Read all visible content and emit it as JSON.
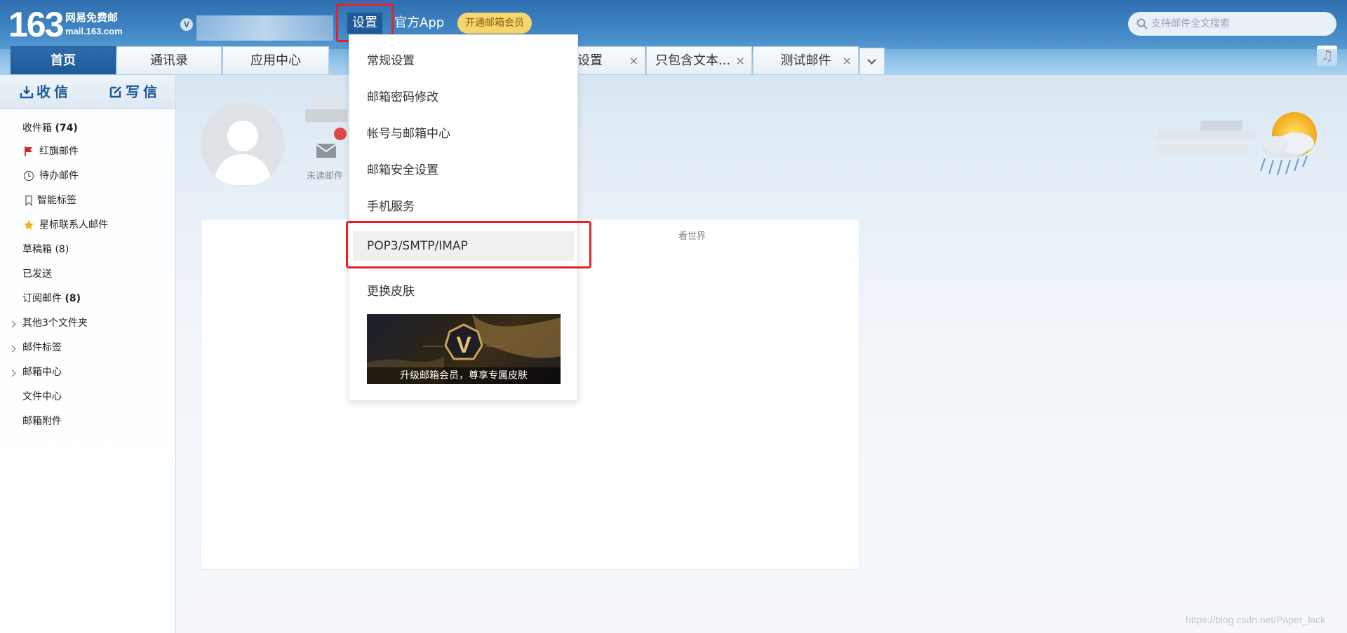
{
  "header": {
    "logo_num": "163",
    "logo_cn": "网易免费邮",
    "logo_en": "mail.163.com",
    "vip_mark": "V",
    "settings_label": "设置",
    "app_label": "官方App",
    "vip_label": "开通邮箱会员",
    "search_placeholder": "支持邮件全文搜索",
    "music_glyph": "♫"
  },
  "tabs": [
    {
      "label": "首页"
    },
    {
      "label": "通讯录"
    },
    {
      "label": "应用中心"
    },
    {
      "label": "设置"
    },
    {
      "label": "只包含文本..."
    },
    {
      "label": "测试邮件"
    }
  ],
  "tab_close_glyph": "×",
  "sidebar": {
    "receive_label": "收信",
    "compose_label": "写信",
    "folders": {
      "inbox": "收件箱",
      "inbox_count": "(74)",
      "flagged": "红旗邮件",
      "todo": "待办邮件",
      "smart_tags": "智能标签",
      "starred": "星标联系人邮件",
      "drafts": "草稿箱 (8)",
      "sent": "已发送",
      "subscriptions": "订阅邮件",
      "subscriptions_count": "(8)",
      "other_folders": "其他3个文件夹",
      "mail_tags": "邮件标签",
      "mail_center": "邮箱中心",
      "file_center": "文件中心",
      "attachments": "邮箱附件"
    }
  },
  "main": {
    "unread_label": "未读邮件",
    "see_world": "看世界"
  },
  "dropdown": {
    "items": [
      "常规设置",
      "邮箱密码修改",
      "帐号与邮箱中心",
      "邮箱安全设置",
      "手机服务",
      "POP3/SMTP/IMAP",
      "更换皮肤"
    ],
    "banner_mark": "V",
    "banner_caption": "升级邮箱会员，尊享专属皮肤"
  },
  "watermark": "https://blog.csdn.net/Paper_lack",
  "colors": {
    "brand_blue": "#1d5a98",
    "highlight_red": "#e8202a",
    "vip_gold": "#f7d76d"
  }
}
